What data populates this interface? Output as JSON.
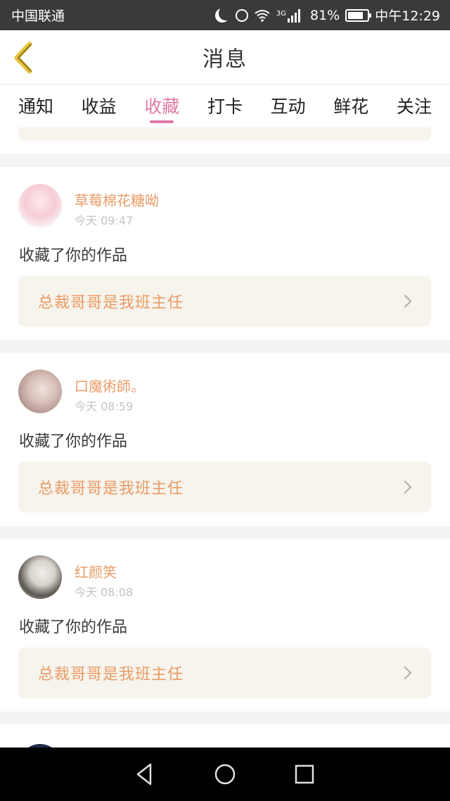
{
  "status_bar": {
    "carrier": "中国联通",
    "network": "3G",
    "battery": "81%",
    "battery_level": 0.81,
    "time": "中午12:29"
  },
  "header": {
    "title": "消息",
    "back_icon": "chevron-left-icon"
  },
  "tabs": [
    {
      "label": "通知",
      "active": false
    },
    {
      "label": "收益",
      "active": false
    },
    {
      "label": "收藏",
      "active": true
    },
    {
      "label": "打卡",
      "active": false
    },
    {
      "label": "互动",
      "active": false
    },
    {
      "label": "鲜花",
      "active": false
    },
    {
      "label": "关注",
      "active": false
    }
  ],
  "feed": [
    {
      "user": "草莓棉花糖呦",
      "time": "今天 09:47",
      "action": "收藏了你的作品",
      "work": "总裁哥哥是我班主任"
    },
    {
      "user": "口魔術師。",
      "time": "今天 08:59",
      "action": "收藏了你的作品",
      "work": "总裁哥哥是我班主任"
    },
    {
      "user": "红颜笑",
      "time": "今天 08:08",
      "action": "收藏了你的作品",
      "work": "总裁哥哥是我班主任"
    }
  ],
  "colors": {
    "accent_pink": "#e07aa7",
    "username_orange": "#ea9b66",
    "back_yellow": "#e8c23a"
  }
}
